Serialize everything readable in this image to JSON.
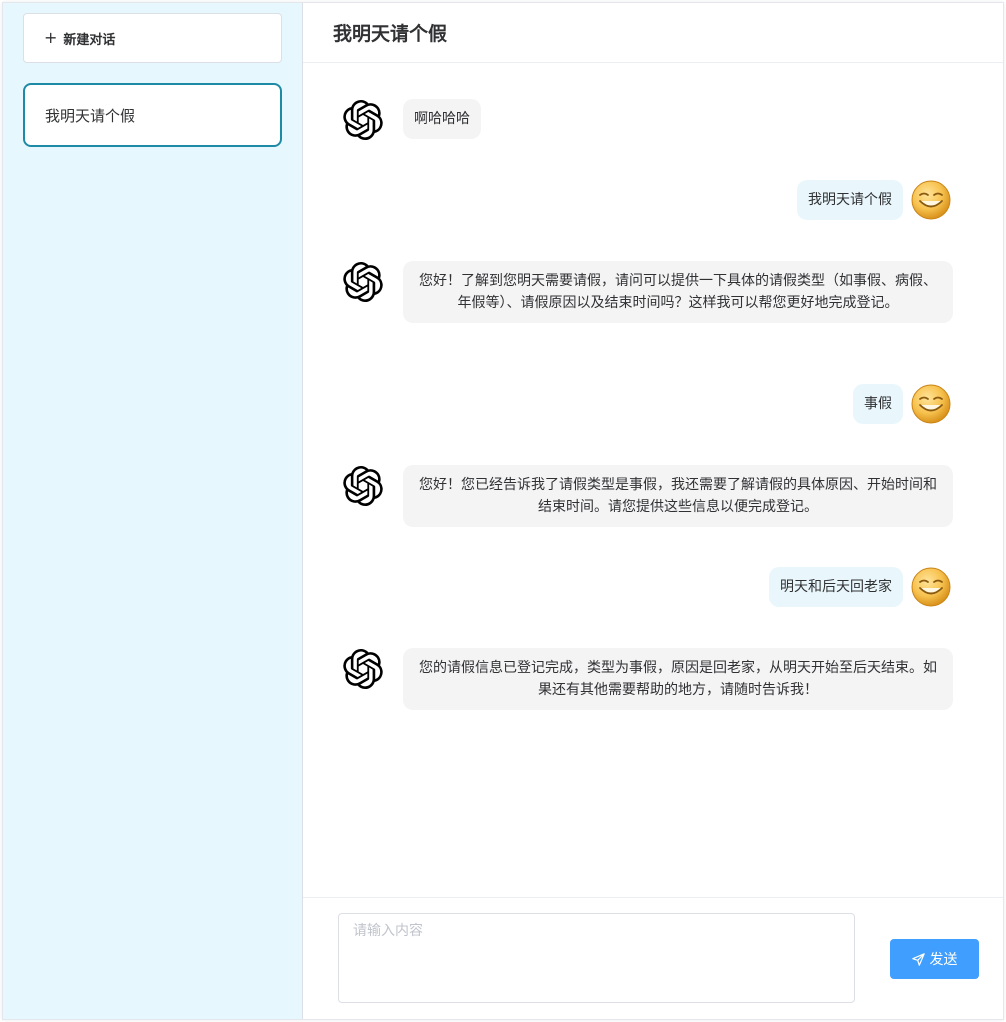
{
  "sidebar": {
    "new_chat_icon": "plus-icon",
    "new_chat_label": "新建对话",
    "sessions": [
      {
        "label": "我明天请个假",
        "active": true
      }
    ]
  },
  "header": {
    "title": "我明天请个假"
  },
  "messages": [
    {
      "role": "assistant",
      "avatar": "openai-logo-icon",
      "text": "啊哈哈哈"
    },
    {
      "role": "user",
      "avatar": "smiley-face-icon",
      "text": "我明天请个假"
    },
    {
      "role": "assistant",
      "avatar": "openai-logo-icon",
      "text": "您好！了解到您明天需要请假，请问可以提供一下具体的请假类型（如事假、病假、年假等）、请假原因以及结束时间吗？这样我可以帮您更好地完成登记。"
    },
    {
      "role": "user",
      "avatar": "smiley-face-icon",
      "text": "事假"
    },
    {
      "role": "assistant",
      "avatar": "openai-logo-icon",
      "text": "您好！您已经告诉我了请假类型是事假，我还需要了解请假的具体原因、开始时间和结束时间。请您提供这些信息以便完成登记。"
    },
    {
      "role": "user",
      "avatar": "smiley-face-icon",
      "text": "明天和后天回老家"
    },
    {
      "role": "assistant",
      "avatar": "openai-logo-icon",
      "text": "您的请假信息已登记完成，类型为事假，原因是回老家，从明天开始至后天结束。如果还有其他需要帮助的地方，请随时告诉我！"
    }
  ],
  "input": {
    "placeholder": "请输入内容",
    "value": ""
  },
  "send": {
    "icon": "send-arrow-icon",
    "label": "发送"
  },
  "colors": {
    "sidebar_bg": "#e6f7fe",
    "active_border": "#1f8aa5",
    "bot_bubble": "#f4f4f5",
    "user_bubble": "#e9f7fd",
    "send_button": "#409eff"
  }
}
